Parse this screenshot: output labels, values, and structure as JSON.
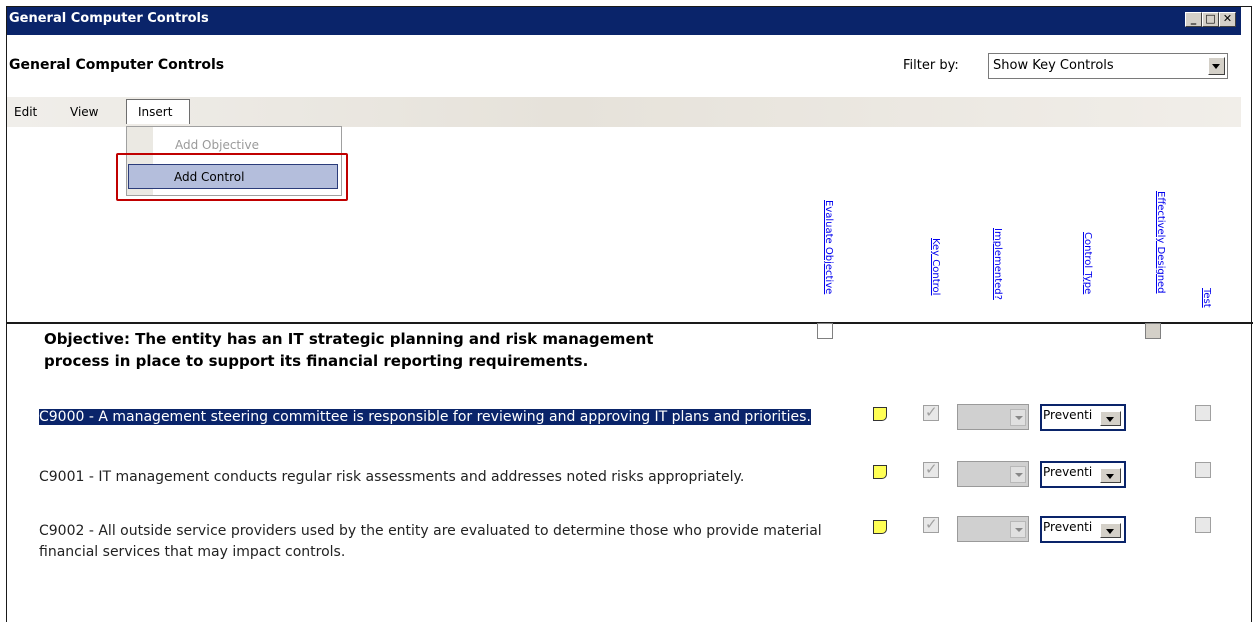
{
  "window": {
    "title": "General Computer Controls",
    "buttons": [
      "_",
      "□",
      "✕"
    ]
  },
  "header": {
    "title": "General Computer Controls",
    "filter_label": "Filter by:",
    "filter_value": "Show Key Controls"
  },
  "menubar": {
    "items": [
      "Edit",
      "View",
      "Insert"
    ]
  },
  "dropdown": {
    "items": [
      "Add Objective",
      "Add Control"
    ]
  },
  "columns": [
    "Evaluate Objective",
    "Key Control",
    "Implemented?",
    "Control Type",
    "Effectively Designed",
    "Test"
  ],
  "objective": {
    "text": "Objective: The entity has an IT strategic planning and risk management process in place to support its financial reporting requirements."
  },
  "controls": [
    {
      "text": "C9000 - A management steering committee is responsible for reviewing and approving IT plans and priorities.",
      "key_control": true,
      "control_type": "Preventi",
      "selected": true
    },
    {
      "text": "C9001 - IT management conducts regular risk assessments and addresses noted risks appropriately.",
      "key_control": true,
      "control_type": "Preventi",
      "selected": false
    },
    {
      "text": "C9002 - All outside service providers used by the entity are evaluated to determine those who provide material financial services that may impact controls.",
      "key_control": true,
      "control_type": "Preventi",
      "selected": false
    }
  ],
  "colors": {
    "titlebar": "#0a246a",
    "highlight": "#0a246a",
    "menu_selected": "#b4bedc",
    "callout": "#c00000",
    "link": "#0000ee"
  }
}
